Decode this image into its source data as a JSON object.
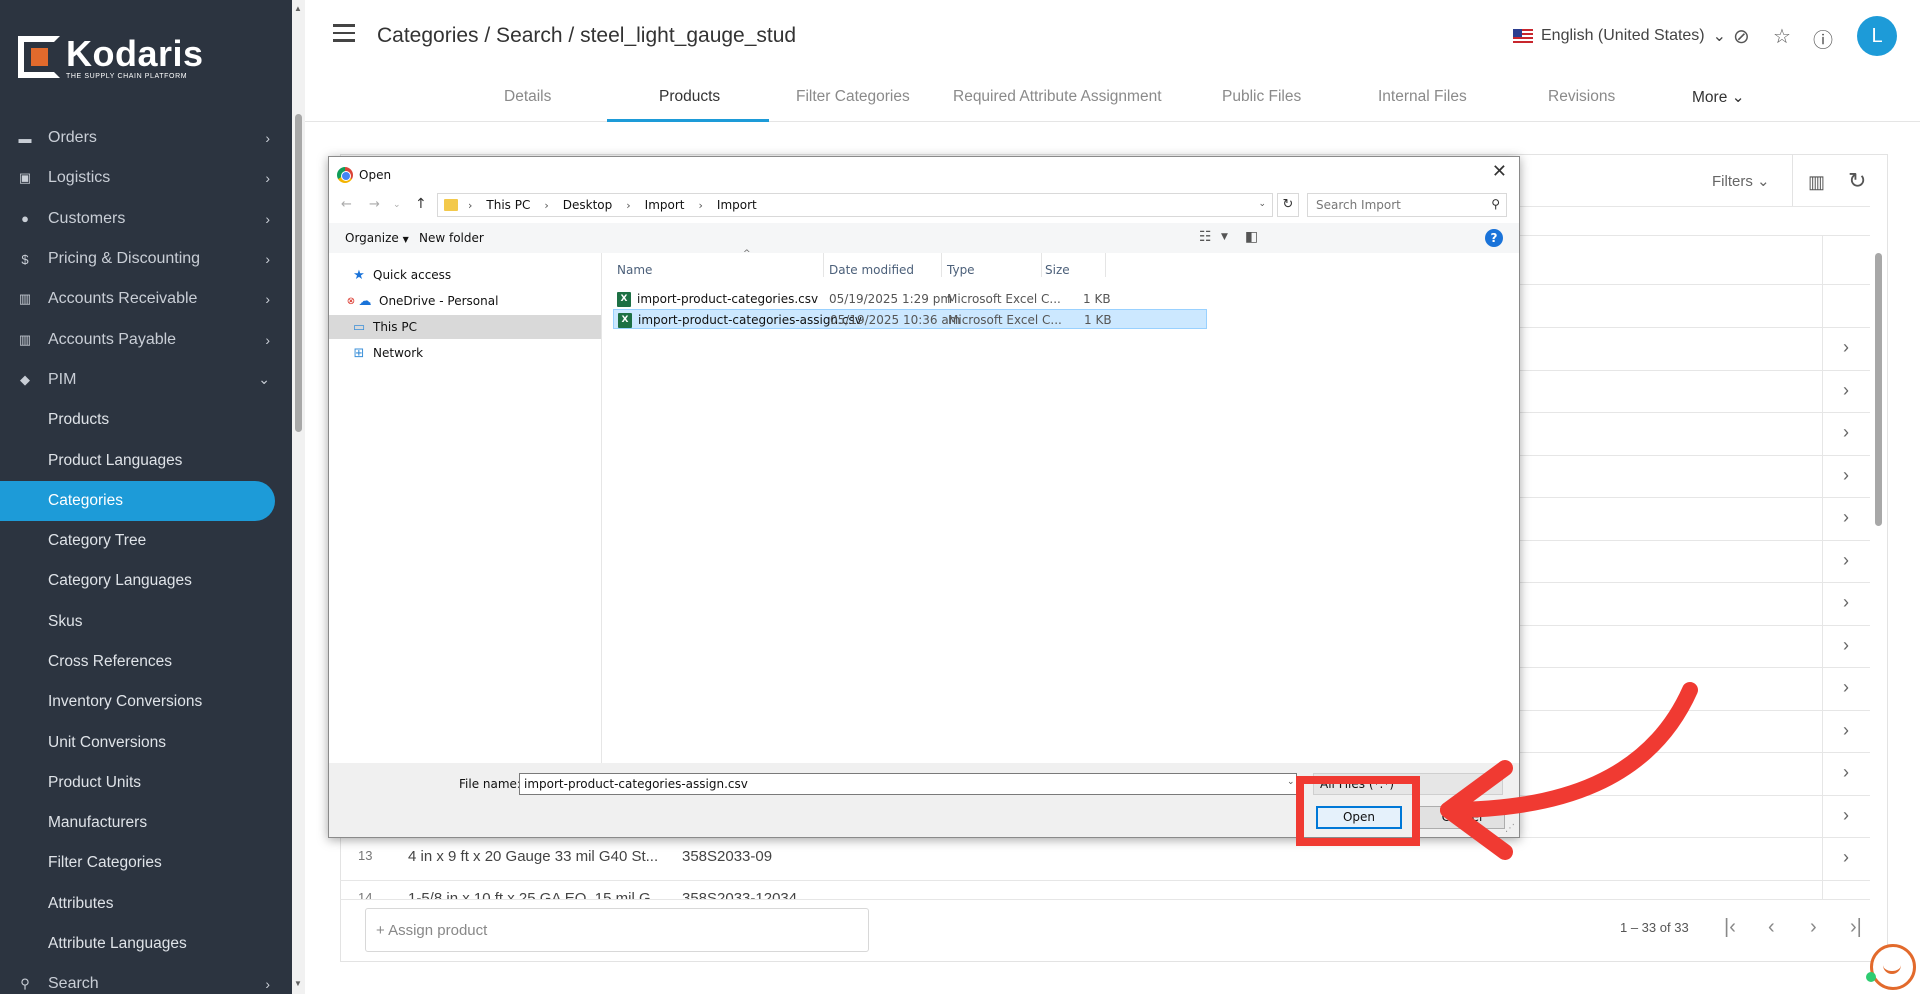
{
  "sidebar": {
    "brand": "Kodaris",
    "tagline": "THE SUPPLY CHAIN PLATFORM",
    "items": [
      {
        "label": "Orders",
        "icon": "truck-icon"
      },
      {
        "label": "Logistics",
        "icon": "shipping-icon"
      },
      {
        "label": "Customers",
        "icon": "people-icon"
      },
      {
        "label": "Pricing & Discounting",
        "icon": "dollar-icon"
      },
      {
        "label": "Accounts Receivable",
        "icon": "bank-icon"
      },
      {
        "label": "Accounts Payable",
        "icon": "bank-icon"
      },
      {
        "label": "PIM",
        "icon": "tag-icon"
      }
    ],
    "sub_items": [
      "Products",
      "Product Languages",
      "Categories",
      "Category Tree",
      "Category Languages",
      "Skus",
      "Cross References",
      "Inventory Conversions",
      "Unit Conversions",
      "Product Units",
      "Manufacturers",
      "Filter Categories",
      "Attributes",
      "Attribute Languages"
    ],
    "active_sub": "Categories",
    "bottom_item": "Search"
  },
  "header": {
    "title": "Categories / Search / steel_light_gauge_stud",
    "language": "English (United States)",
    "avatar_initial": "L",
    "tabs": [
      "Details",
      "Products",
      "Filter Categories",
      "Required Attribute Assignment",
      "Public Files",
      "Internal Files",
      "Revisions",
      "More"
    ],
    "active_tab": "Products"
  },
  "main": {
    "filters_label": "Filters",
    "visible_rows": [
      {
        "num": "13",
        "name": "4 in x 9 ft x 20 Gauge 33 mil G40 St...",
        "sku": "358S2033-09"
      },
      {
        "num": "14",
        "name": "1-5/8 in x 10 ft x 25 GA EQ. 15 mil G...",
        "sku": "358S2033-12034"
      }
    ],
    "assign_placeholder": "+ Assign product",
    "pagination": "1 – 33 of 33"
  },
  "dialog": {
    "title": "Open",
    "path": [
      "This PC",
      "Desktop",
      "Import",
      "Import"
    ],
    "search_placeholder": "Search Import",
    "organize": "Organize",
    "new_folder": "New folder",
    "nav_items": [
      {
        "label": "Quick access",
        "icon": "star-icon"
      },
      {
        "label": "OneDrive - Personal",
        "icon": "cloud-icon"
      },
      {
        "label": "This PC",
        "icon": "computer-icon"
      },
      {
        "label": "Network",
        "icon": "network-icon"
      }
    ],
    "selected_nav": "This PC",
    "columns": [
      "Name",
      "Date modified",
      "Type",
      "Size"
    ],
    "files": [
      {
        "name": "import-product-categories.csv",
        "date": "05/19/2025 1:29 pm",
        "type": "Microsoft Excel C...",
        "size": "1 KB"
      },
      {
        "name": "import-product-categories-assign.csv",
        "date": "05/19/2025 10:36 am",
        "type": "Microsoft Excel C...",
        "size": "1 KB"
      }
    ],
    "selected_file": "import-product-categories-assign.csv",
    "file_name_label": "File name:",
    "file_name_value": "import-product-categories-assign.csv",
    "file_type": "All Files (*.*)",
    "open_label": "Open",
    "cancel_label": "Cancel"
  },
  "annotation": {
    "color": "#f03a32"
  }
}
